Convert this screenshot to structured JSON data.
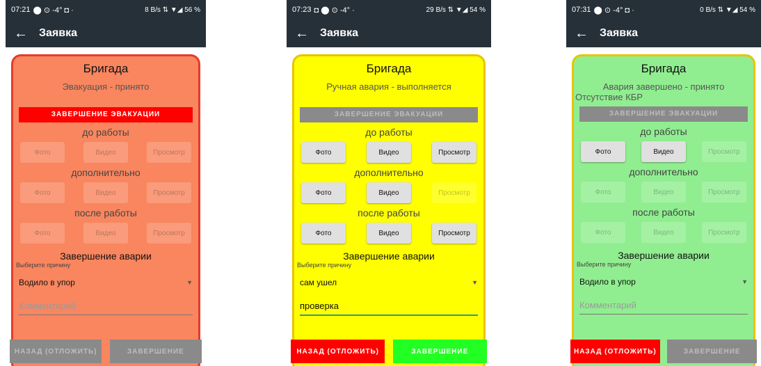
{
  "panels": [
    {
      "id": "orange",
      "status_bar": {
        "time": "07:21",
        "indicators": "⬤ ⊙ -4° ◘ ·",
        "right": "8 B/s ⇅ ▼◢ 56 %"
      },
      "app_bar": {
        "back": "←",
        "title": "Заявка"
      },
      "colors": {
        "bg": "#f9865f",
        "border": "#e53b2a",
        "primary_btn": "#ff0000",
        "primary_text": "#ffffff"
      },
      "brigade": "Бригада",
      "status_text": "Эвакуация - принято",
      "extra_text": "",
      "evac_button": "ЗАВЕРШЕНИЕ ЭВАКУАЦИИ",
      "before_label": "до работы",
      "additional_label": "дополнительно",
      "after_label": "после работы",
      "buttons": {
        "photo": "Фото",
        "video": "Видео",
        "view": "Просмотр"
      },
      "finish_label": "Завершение аварии",
      "reason_hint": "Выберите причину",
      "reason_value": "Водило в упор",
      "comment": "Комментарий",
      "back_btn": "НАЗАД (ОТЛОЖИТЬ)",
      "done_btn": "ЗАВЕРШЕНИЕ"
    },
    {
      "id": "yellow",
      "status_bar": {
        "time": "07:23",
        "indicators": "◘ ⬤ ⊙ -4° ·",
        "right": "29 B/s ⇅ ▼◢ 54 %"
      },
      "app_bar": {
        "back": "←",
        "title": "Заявка"
      },
      "colors": {
        "bg": "#ffff00",
        "border": "#e8c400",
        "primary_btn": "#8a8a8a",
        "primary_text": "#bdbdbd"
      },
      "brigade": "Бригада",
      "status_text": "Ручная авария - выполняется",
      "extra_text": "",
      "evac_button": "ЗАВЕРШЕНИЕ ЭВАКУАЦИИ",
      "before_label": "до работы",
      "additional_label": "дополнительно",
      "after_label": "после работы",
      "buttons": {
        "photo": "Фото",
        "video": "Видео",
        "view": "Просмотр"
      },
      "finish_label": "Завершение аварии",
      "reason_hint": "Выберите причину",
      "reason_value": "сам ушел",
      "comment": "проверка",
      "back_btn": "НАЗАД (ОТЛОЖИТЬ)",
      "done_btn": "ЗАВЕРШЕНИЕ"
    },
    {
      "id": "green",
      "status_bar": {
        "time": "07:31",
        "indicators": "⬤ ⊙ -4° ◘ ·",
        "right": "0 B/s ⇅ ▼◢ 54 %"
      },
      "app_bar": {
        "back": "←",
        "title": "Заявка"
      },
      "colors": {
        "bg": "#90ee90",
        "border": "#e8c400",
        "primary_btn": "#8a8a8a",
        "primary_text": "#bdbdbd"
      },
      "brigade": "Бригада",
      "status_text": "Авария завершено - принято",
      "extra_text": "Отсутствие КБР",
      "evac_button": "ЗАВЕРШЕНИЕ ЭВАКУАЦИИ",
      "before_label": "до работы",
      "additional_label": "дополнительно",
      "after_label": "после работы",
      "buttons": {
        "photo": "Фото",
        "video": "Видео",
        "view": "Просмотр"
      },
      "finish_label": "Завершение аварии",
      "reason_hint": "Выберите причину",
      "reason_value": "Водило в упор",
      "comment": "Комментарий",
      "back_btn": "НАЗАД (ОТЛОЖИТЬ)",
      "done_btn": "ЗАВЕРШЕНИЕ"
    }
  ]
}
